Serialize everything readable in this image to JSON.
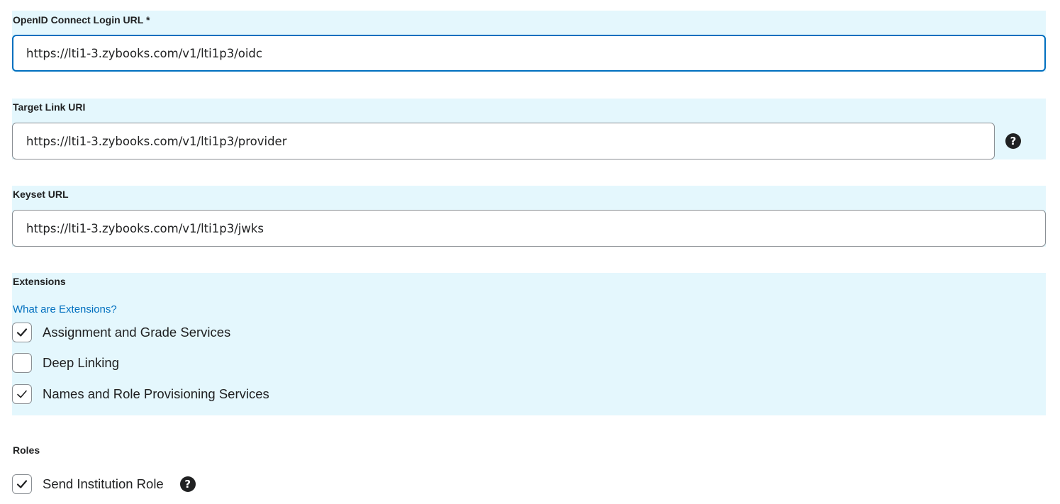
{
  "oidc": {
    "label": "OpenID Connect Login URL *",
    "value": "https://lti1-3.zybooks.com/v1/lti1p3/oidc"
  },
  "target_link": {
    "label": "Target Link URI",
    "value": "https://lti1-3.zybooks.com/v1/lti1p3/provider",
    "help_icon": "question-circle-icon"
  },
  "keyset": {
    "label": "Keyset URL",
    "value": "https://lti1-3.zybooks.com/v1/lti1p3/jwks"
  },
  "extensions": {
    "label": "Extensions",
    "link": "What are Extensions?",
    "items": [
      {
        "label": "Assignment and Grade Services",
        "checked": true
      },
      {
        "label": "Deep Linking",
        "checked": false
      },
      {
        "label": "Names and Role Provisioning Services",
        "checked": true
      }
    ]
  },
  "roles": {
    "label": "Roles",
    "items": [
      {
        "label": "Send Institution Role",
        "checked": true,
        "help_icon": "question-circle-icon"
      }
    ]
  },
  "colors": {
    "band": "#e4f7fd",
    "accent": "#006fbf",
    "text": "#202122",
    "border": "#8a8f94"
  }
}
